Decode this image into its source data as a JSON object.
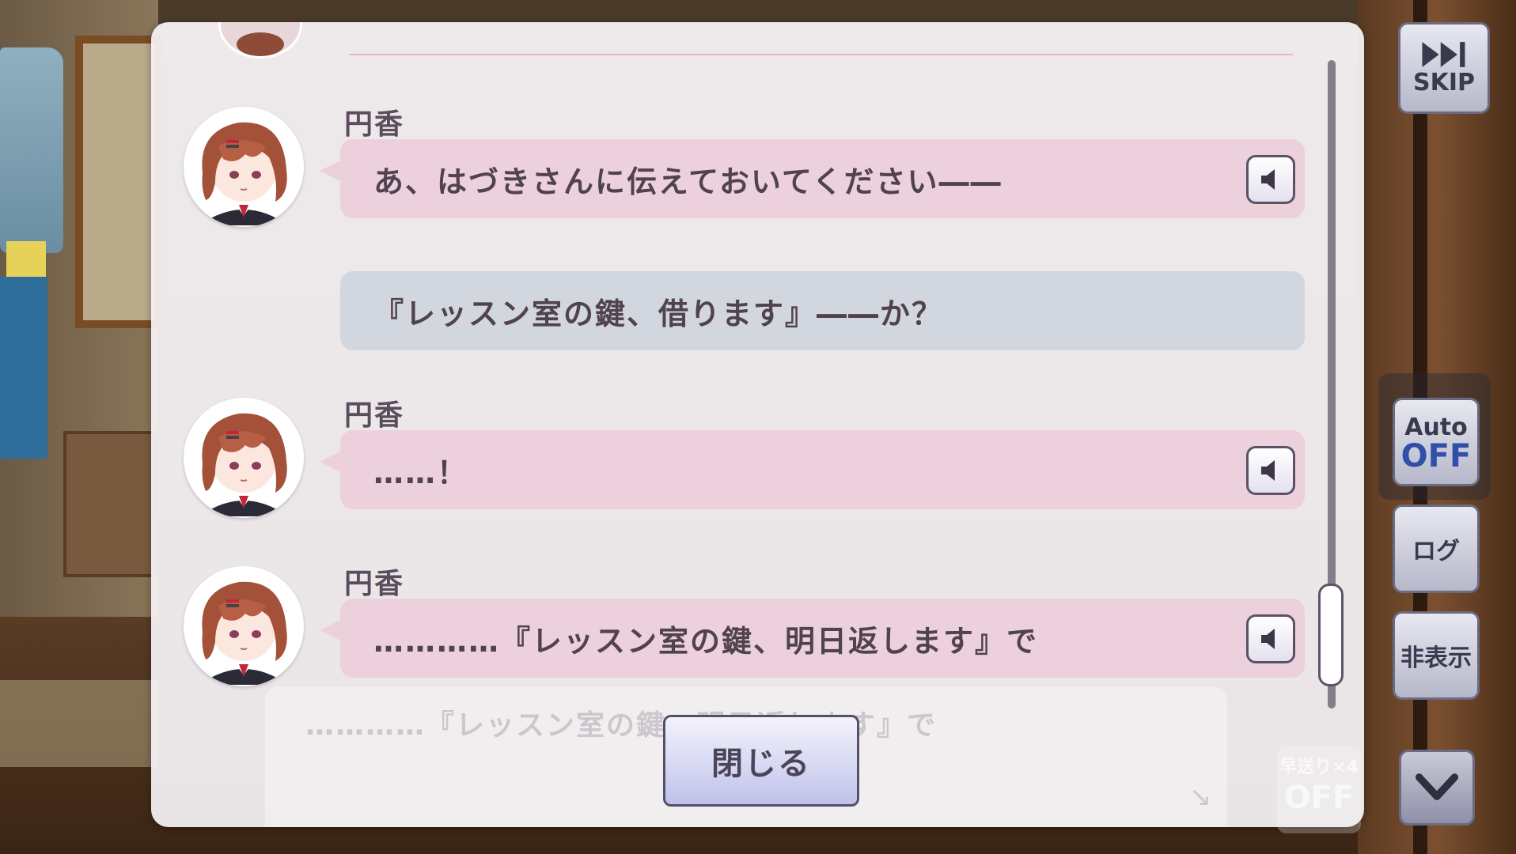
{
  "log": {
    "entries": [
      {
        "speaker": "円香",
        "text": "あ、はづきさんに伝えておいてください――",
        "kind": "character"
      },
      {
        "speaker": "",
        "text": "『レッスン室の鍵、借ります』――か？",
        "kind": "narration"
      },
      {
        "speaker": "円香",
        "text": "……！",
        "kind": "character"
      },
      {
        "speaker": "円香",
        "text": "…………『レッスン室の鍵、明日返します』で",
        "kind": "character"
      }
    ],
    "close_label": "閉じる"
  },
  "background_message": {
    "text": "…………『レッスン室の鍵、明日返します』で"
  },
  "controls": {
    "skip_label": "SKIP",
    "auto_label": "Auto",
    "auto_state": "OFF",
    "log_label": "ログ",
    "hide_label": "非表示",
    "fast_forward_label": "早送り×4",
    "fast_forward_state": "OFF"
  },
  "colors": {
    "bubble_character": "#ecd1dd",
    "bubble_narration": "#d2d6de",
    "auto_off": "#2f4fa8"
  }
}
